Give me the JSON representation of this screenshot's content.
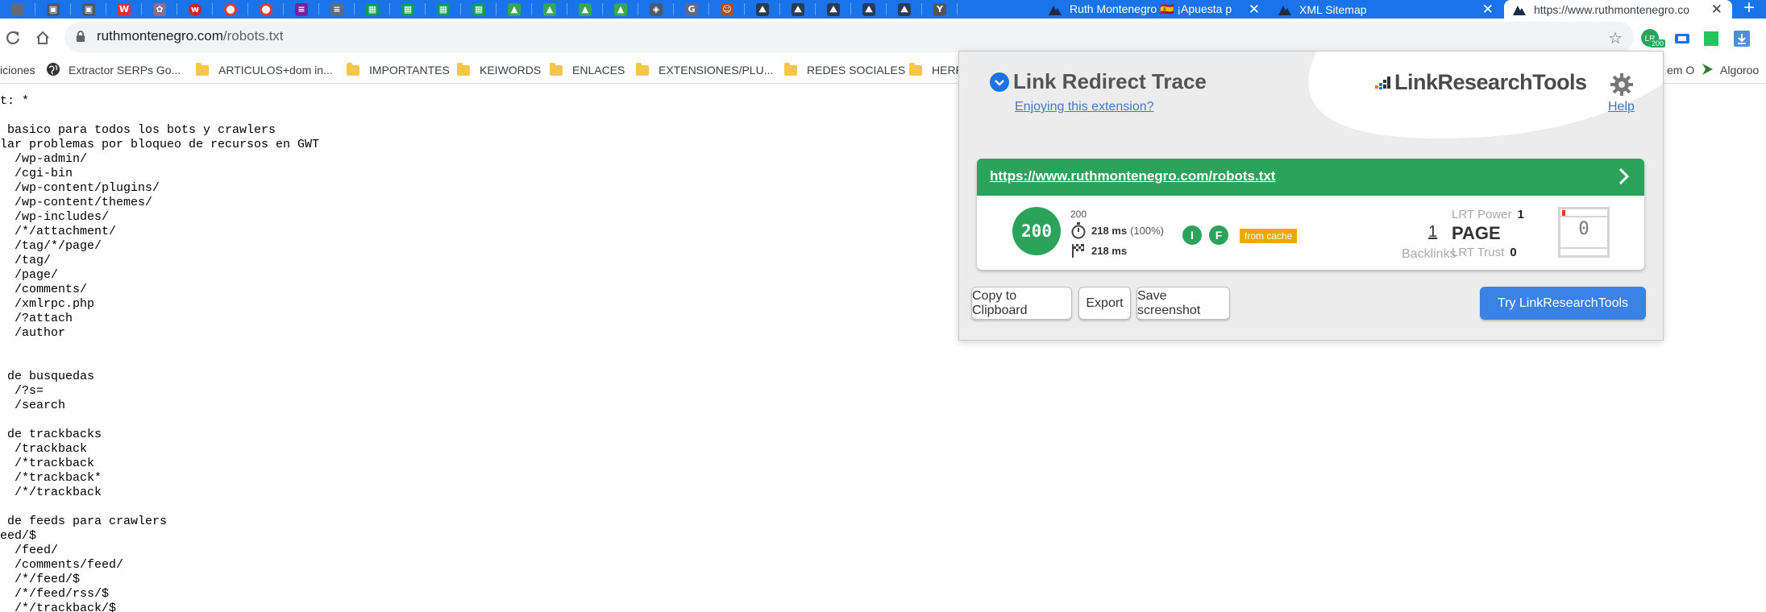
{
  "browser": {
    "tabs": [
      {
        "title": "Ruth Montenegro 🇪🇸 ¡Apuesta p"
      },
      {
        "title": "XML Sitemap"
      },
      {
        "title": "https://www.ruthmontenegro.co"
      }
    ],
    "new_tab": "+",
    "close_glyph": "✕",
    "url_host": "ruthmontenegro.com",
    "url_path": "/robots.txt",
    "extension_badge": "200"
  },
  "bookmarks": [
    {
      "label": "iciones",
      "icon": "none"
    },
    {
      "label": "Extractor SERPs Go...",
      "icon": "globe-icon"
    },
    {
      "label": "ARTICULOS+dom in...",
      "icon": "folder-icon"
    },
    {
      "label": "IMPORTANTES",
      "icon": "folder-icon"
    },
    {
      "label": "KEIWORDS",
      "icon": "folder-icon"
    },
    {
      "label": "ENLACES",
      "icon": "folder-icon"
    },
    {
      "label": "EXTENSIONES/PLU...",
      "icon": "folder-icon"
    },
    {
      "label": "REDES SOCIALES",
      "icon": "folder-icon"
    },
    {
      "label": "HERR",
      "icon": "folder-icon"
    },
    {
      "label": "em O",
      "icon": "none"
    },
    {
      "label": "Algoroo",
      "icon": "play-icon"
    }
  ],
  "robots_lines": [
    "t: *",
    "",
    " basico para todos los bots y crawlers",
    "lar problemas por bloqueo de recursos en GWT",
    "  /wp-admin/",
    "  /cgi-bin",
    "  /wp-content/plugins/",
    "  /wp-content/themes/",
    "  /wp-includes/",
    "  /*/attachment/",
    "  /tag/*/page/",
    "  /tag/",
    "  /page/",
    "  /comments/",
    "  /xmlrpc.php",
    "  /?attach",
    "  /author",
    "",
    "",
    " de busquedas",
    "  /?s=",
    "  /search",
    "",
    " de trackbacks",
    "  /trackback",
    "  /*trackback",
    "  /*trackback*",
    "  /*/trackback",
    "",
    " de feeds para crawlers",
    "eed/$",
    "  /feed/",
    "  /comments/feed/",
    "  /*/feed/$",
    "  /*/feed/rss/$",
    "  /*/trackback/$"
  ],
  "popup": {
    "title": "Link Redirect Trace",
    "enjoy_link": "Enjoying this extension?",
    "brand": "LinkResearchTools",
    "help": "Help",
    "result": {
      "url": "https://www.ruthmontenegro.com/robots.txt",
      "status": "200",
      "status_small": "200",
      "time": "218 ms",
      "time_pct": "(100%)",
      "total_time": "218 ms",
      "badge_i": "I",
      "badge_f": "F",
      "cache": "from cache",
      "backlinks_count": "1",
      "backlinks_label": "Backlinks",
      "lrt_power_label": "LRT Power",
      "lrt_power_value": "1",
      "lrt_power_fraction": 0.08,
      "page_label": "PAGE",
      "lrt_trust_label": "LRT Trust",
      "lrt_trust_value": "0",
      "meter_value": "0"
    },
    "buttons": {
      "copy": "Copy to Clipboard",
      "export": "Export",
      "screenshot": "Save screenshot",
      "try": "Try LinkResearchTools"
    }
  },
  "colors": {
    "tabstrip": "#1a73e8",
    "success_green": "#2ca35a",
    "cache_badge": "#f0a800",
    "primary_button": "#3b82e6",
    "power_bar": "#e53935"
  }
}
